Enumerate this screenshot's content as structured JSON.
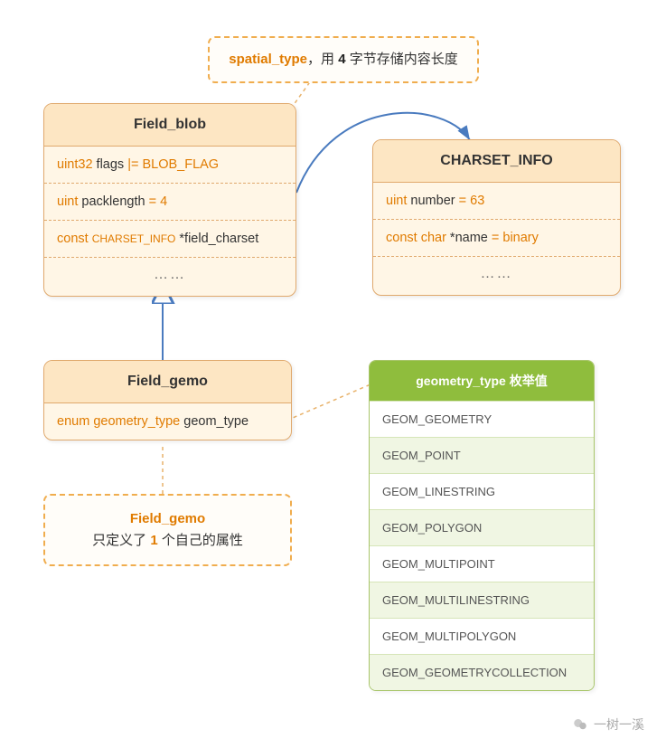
{
  "callout_top": {
    "kw": "spatial_type",
    "sep": "，用 ",
    "bold_num": "4",
    "tail": " 字节存储内容长度"
  },
  "field_blob": {
    "title": "Field_blob",
    "row1_type": "uint32",
    "row1_name": " flags ",
    "row1_op": "|= ",
    "row1_val": "BLOB_FLAG",
    "row2_type": "uint",
    "row2_name": " packlength ",
    "row2_eq": "= ",
    "row2_val": "4",
    "row3_const": "const ",
    "row3_type": "CHARSET_INFO",
    "row3_name": " *field_charset",
    "ellipsis": "……"
  },
  "charset_info": {
    "title": "CHARSET_INFO",
    "row1_type": "uint",
    "row1_name": " number ",
    "row1_eq": "= ",
    "row1_val": "63",
    "row2_const": "const ",
    "row2_type": "char",
    "row2_name": " *name ",
    "row2_eq": "= ",
    "row2_val": "binary",
    "ellipsis": "……"
  },
  "field_gemo": {
    "title": "Field_gemo",
    "row1_enum": "enum ",
    "row1_type": "geometry_type",
    "row1_name": " geom_type"
  },
  "callout_bottom": {
    "title": "Field_gemo",
    "line2a": "只定义了 ",
    "line2b": "1",
    "line2c": " 个自己的属性"
  },
  "enum_table": {
    "header": "geometry_type 枚举值",
    "rows": [
      "GEOM_GEOMETRY",
      "GEOM_POINT",
      "GEOM_LINESTRING",
      "GEOM_POLYGON",
      "GEOM_MULTIPOINT",
      "GEOM_MULTILINESTRING",
      "GEOM_MULTIPOLYGON",
      "GEOM_GEOMETRYCOLLECTION"
    ]
  },
  "watermark": "一树一溪"
}
